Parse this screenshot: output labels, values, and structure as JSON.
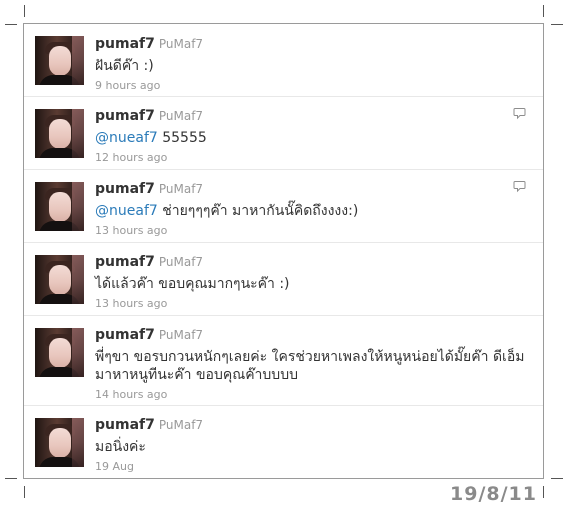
{
  "date_stamp": "19/8/11",
  "tweets": [
    {
      "screen_name": "pumaf7",
      "full_name": "PuMaf7",
      "mention": "",
      "text": "ฝันดีค๊า :)",
      "time": "9 hours ago",
      "icon": "avatar-photo",
      "has_reply_icon": false
    },
    {
      "screen_name": "pumaf7",
      "full_name": "PuMaf7",
      "mention": "@nueaf7",
      "text": " 55555",
      "time": "12 hours ago",
      "icon": "avatar-photo",
      "has_reply_icon": true
    },
    {
      "screen_name": "pumaf7",
      "full_name": "PuMaf7",
      "mention": "@nueaf7",
      "text": " ช่ายๆๆๆค๊า มาหากันนั๊คิดถึงงงง:)",
      "time": "13 hours ago",
      "icon": "avatar-photo",
      "has_reply_icon": true
    },
    {
      "screen_name": "pumaf7",
      "full_name": "PuMaf7",
      "mention": "",
      "text": "ได้แล้วค๊า ขอบคุณมากๆนะค๊า :)",
      "time": "13 hours ago",
      "icon": "avatar-photo",
      "has_reply_icon": false
    },
    {
      "screen_name": "pumaf7",
      "full_name": "PuMaf7",
      "mention": "",
      "text": "พี่ๆขา ขอรบกวนหนักๆเลยค่ะ ใครช่วยหาเพลงให้หนูหน่อยได้มั๊ยค๊า ดีเอ็ม มาหาหนูทีนะค๊า ขอบคุณค๊าบบบบ",
      "time": "14 hours ago",
      "icon": "avatar-photo",
      "has_reply_icon": false
    },
    {
      "screen_name": "pumaf7",
      "full_name": "PuMaf7",
      "mention": "",
      "text": "มอนิ่งค่ะ",
      "time": "19 Aug",
      "icon": "avatar-photo",
      "has_reply_icon": false
    }
  ]
}
